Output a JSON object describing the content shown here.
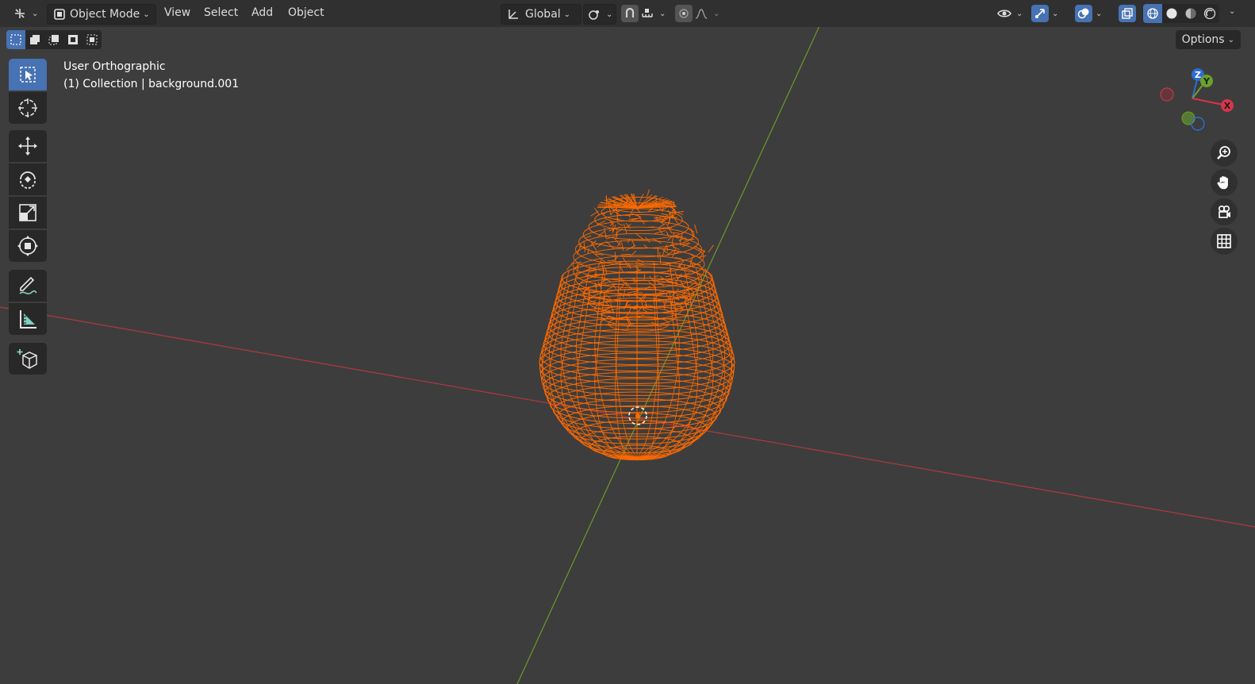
{
  "header": {
    "mode_label": "Object Mode",
    "menus": [
      "View",
      "Select",
      "Add",
      "Object"
    ],
    "transform_orientation": "Global",
    "options_label": "Options"
  },
  "viewport": {
    "view_name": "User Orthographic",
    "collection_label": "(1) Collection | background.001",
    "object_color": "#ff6a00",
    "x_axis_color": "#b03844",
    "y_axis_color": "#6b9a2a"
  },
  "gizmo": {
    "labels": [
      "Z",
      "Y",
      "X"
    ]
  },
  "toolbar": {
    "tools": [
      "select-box",
      "cursor",
      "move",
      "rotate",
      "scale",
      "transform",
      "annotate",
      "measure",
      "add-cube"
    ],
    "active_tool": "select-box"
  },
  "colors": {
    "accent": "#4772b3",
    "panel": "#282828",
    "header": "#303030",
    "background": "#3d3d3d"
  }
}
